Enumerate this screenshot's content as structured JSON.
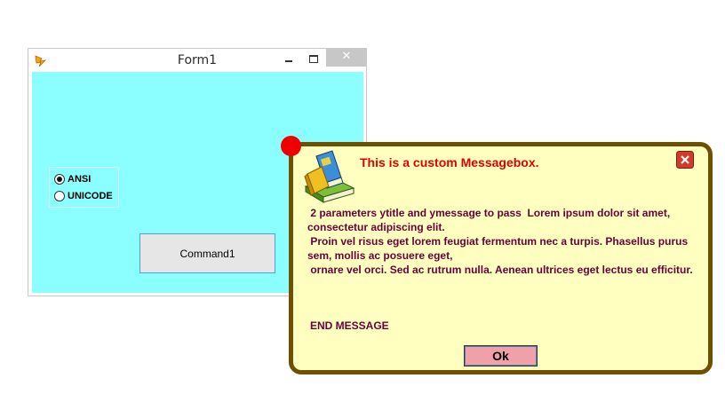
{
  "form1": {
    "title": "Form1",
    "close_glyph": "✕",
    "options": [
      {
        "label": "ANSI",
        "checked": true
      },
      {
        "label": "UNICODE",
        "checked": false
      }
    ],
    "command_label": "Command1",
    "client_color": "#8bffff",
    "app_icon": "vb-app-icon"
  },
  "messagebox": {
    "title": "This is a custom Messagebox.",
    "body": " 2 parameters ytitle and ymessage to pass  Lorem ipsum dolor sit amet, consectetur adipiscing elit.\n Proin vel risus eget lorem feugiat fermentum nec a turpis. Phasellus purus sem, mollis ac posuere eget,\n ornare vel orci. Sed ac rutrum nulla. Aenean ultrices eget lectus eu efficitur.",
    "end_text": "END MESSAGE",
    "ok_label": "Ok",
    "icon": "books-icon",
    "title_color": "#e00000",
    "text_color": "#6b0038",
    "background_color": "#ffffc0",
    "border_color": "#6e5000"
  }
}
